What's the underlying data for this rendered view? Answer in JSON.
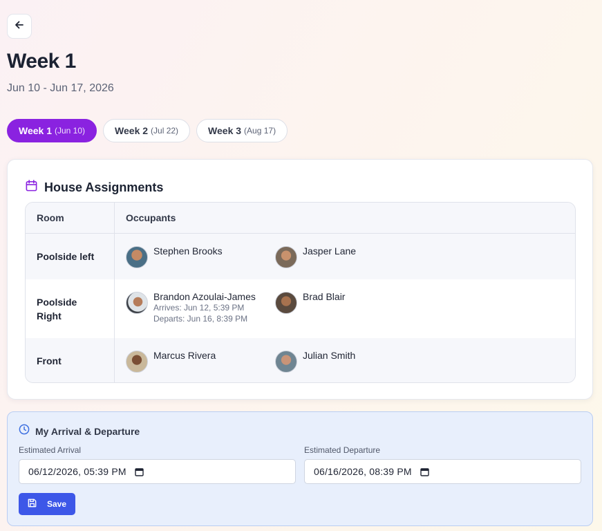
{
  "page": {
    "title": "Week 1",
    "date_range": "Jun 10 - Jun 17, 2026"
  },
  "tabs": [
    {
      "label": "Week 1",
      "date": "(Jun 10)",
      "active": true
    },
    {
      "label": "Week 2",
      "date": "(Jul 22)",
      "active": false
    },
    {
      "label": "Week 3",
      "date": "(Aug 17)",
      "active": false
    }
  ],
  "assignments": {
    "title": "House Assignments",
    "headers": {
      "room": "Room",
      "occupants": "Occupants"
    },
    "rows": [
      {
        "room": "Poolside left",
        "occupants": [
          {
            "name": "Stephen Brooks"
          },
          {
            "name": "Jasper Lane"
          }
        ]
      },
      {
        "room": "Poolside Right",
        "occupants": [
          {
            "name": "Brandon Azoulai-James",
            "arrives": "Arrives: Jun 12, 5:39 PM",
            "departs": "Departs: Jun 16, 8:39 PM"
          },
          {
            "name": "Brad Blair"
          }
        ]
      },
      {
        "room": "Front",
        "occupants": [
          {
            "name": "Marcus Rivera"
          },
          {
            "name": "Julian Smith"
          }
        ]
      }
    ]
  },
  "arrival": {
    "title": "My Arrival & Departure",
    "arrival_label": "Estimated Arrival",
    "arrival_value": "06/12/2026, 05:39 PM",
    "departure_label": "Estimated Departure",
    "departure_value": "06/16/2026, 08:39 PM",
    "save_label": "Save"
  },
  "colors": {
    "accent_purple": "#8a22e0",
    "save_blue": "#3d57e8",
    "panel_blue": "#e8effc"
  },
  "icons": {
    "back": "arrow-left-icon",
    "assignments": "calendar-icon",
    "arrival": "clock-icon",
    "save": "floppy-disk-icon",
    "datetime": "calendar-icon"
  }
}
